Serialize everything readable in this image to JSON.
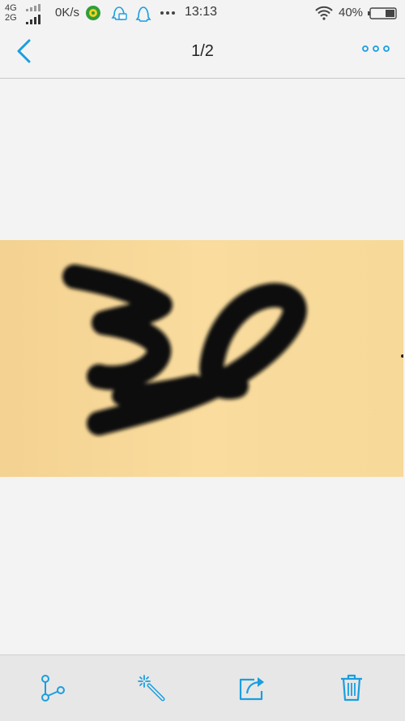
{
  "status_bar": {
    "network_top": "4G",
    "network_bottom": "2G",
    "speed": "0K/s",
    "time": "13:13",
    "battery": "40%"
  },
  "nav": {
    "page_indicator": "1/2"
  },
  "colors": {
    "accent": "#1a9ee0",
    "photo_background": "#f8d898",
    "ink": "#0d0c0a"
  },
  "toolbar": {
    "icons": [
      "share-graph-icon",
      "magic-wand-icon",
      "export-icon",
      "trash-icon"
    ]
  }
}
